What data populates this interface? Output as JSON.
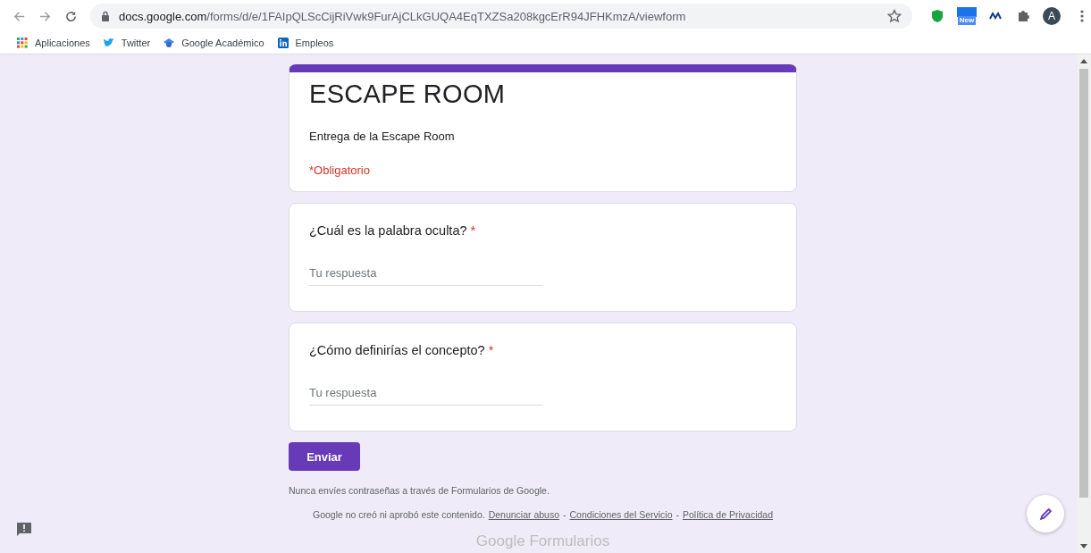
{
  "browser": {
    "url_host": "docs.google.com",
    "url_path": "/forms/d/e/1FAIpQLScCijRiVwk9FurAjCLkGUQA4EqTXZSa208kgcErR94JFHKmzA/viewform",
    "extension_badge": "New",
    "avatar_letter": "A"
  },
  "bookmarks": [
    {
      "label": "Aplicaciones",
      "kind": "apps"
    },
    {
      "label": "Twitter",
      "kind": "twitter"
    },
    {
      "label": "Google Académico",
      "kind": "scholar"
    },
    {
      "label": "Empleos",
      "kind": "linkedin"
    }
  ],
  "form": {
    "title": "ESCAPE ROOM",
    "description": "Entrega de la Escape Room",
    "required_note": "*Obligatorio",
    "questions": [
      {
        "label": "¿Cuál es la palabra oculta?",
        "required": true,
        "placeholder": "Tu respuesta"
      },
      {
        "label": "¿Cómo definirías el concepto?",
        "required": true,
        "placeholder": "Tu respuesta"
      }
    ],
    "submit": "Enviar",
    "warning": "Nunca envíes contraseñas a través de Formularios de Google.",
    "disclaimer": "Google no creó ni aprobó este contenido.",
    "links": [
      "Denunciar abuso",
      "Condiciones del Servicio",
      "Política de Privacidad"
    ],
    "separator": "-",
    "required_mark": "*",
    "brand": "Google Formularios"
  }
}
